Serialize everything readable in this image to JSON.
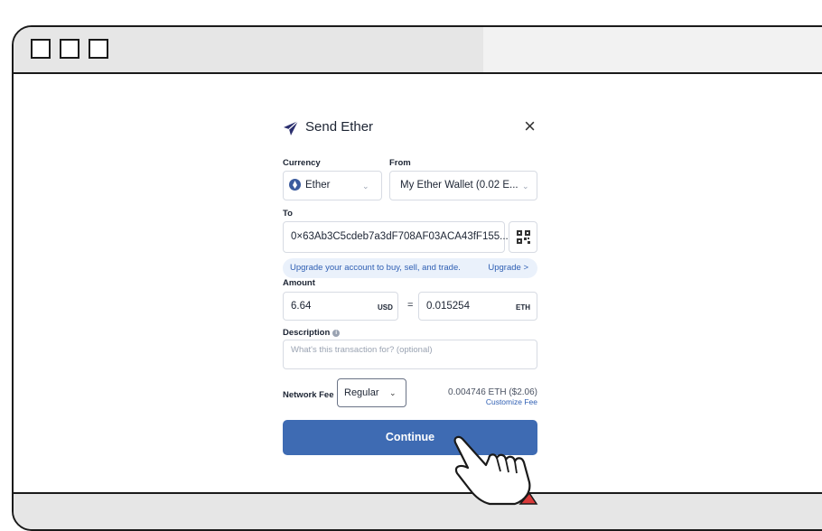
{
  "dialog": {
    "title": "Send Ether",
    "close_glyph": "×",
    "currency": {
      "label": "Currency",
      "value": "Ether"
    },
    "from": {
      "label": "From",
      "value": "My Ether Wallet (0.02 E..."
    },
    "to": {
      "label": "To",
      "value": "0×63Ab3C5cdeb7a3dF708AF03ACA43fF155..."
    },
    "banner": {
      "text": "Upgrade your account to buy, sell, and trade.",
      "link": "Upgrade >"
    },
    "amount": {
      "label": "Amount",
      "usd_value": "6.64",
      "usd_unit": "USD",
      "equals": "=",
      "eth_value": "0.015254",
      "eth_unit": "ETH"
    },
    "description": {
      "label": "Description",
      "placeholder": "What's this transaction for? (optional)"
    },
    "fee": {
      "label": "Network Fee",
      "option": "Regular",
      "value": "0.004746 ETH ($2.06)",
      "customize": "Customize Fee"
    },
    "continue_label": "Continue"
  },
  "colors": {
    "accent": "#3e6bb3",
    "link": "#2f5fb3",
    "banner_bg": "#eaf1fb"
  },
  "icons": [
    "send-icon",
    "close-icon",
    "ether-icon",
    "chevron-down-icon",
    "qr-code-icon",
    "info-icon",
    "pointing-hand-cursor"
  ]
}
